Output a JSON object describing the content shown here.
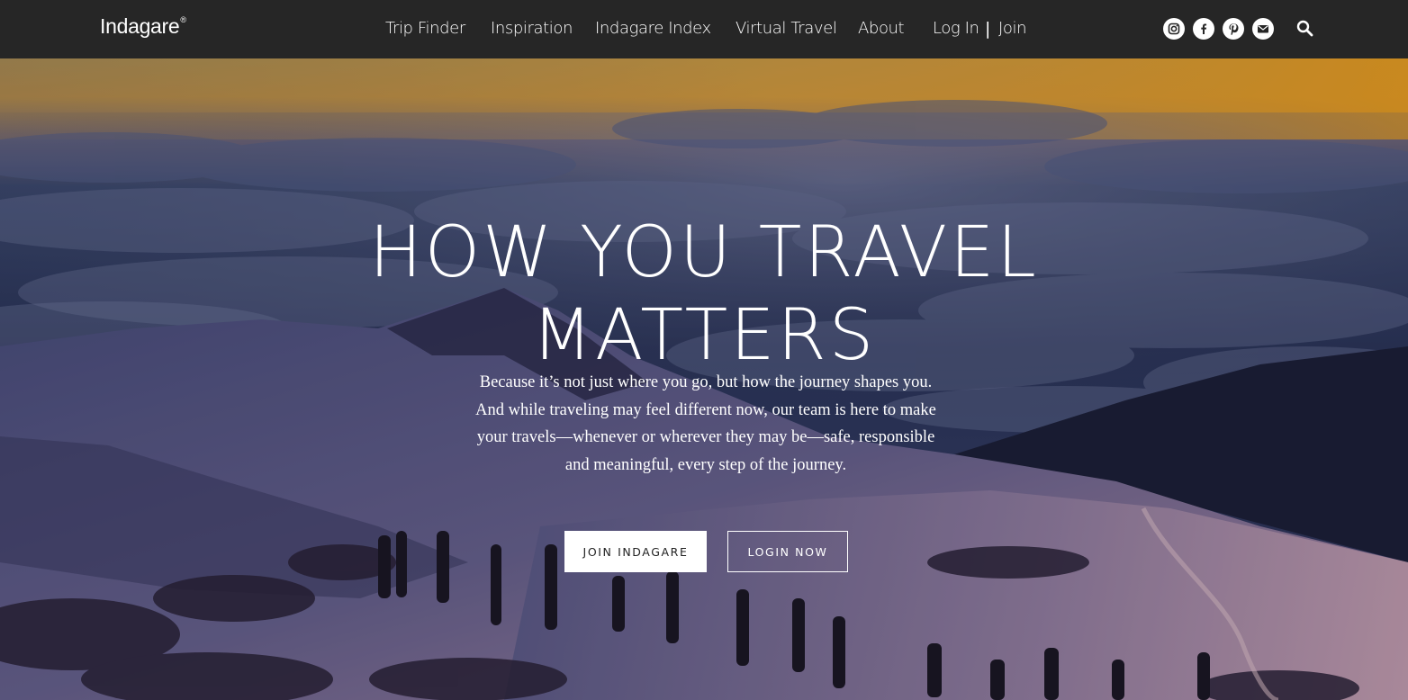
{
  "brand": {
    "name": "Indagare",
    "mark": "®"
  },
  "nav": {
    "items": [
      {
        "label": "Trip Finder"
      },
      {
        "label": "Inspiration"
      },
      {
        "label": "Indagare Index"
      },
      {
        "label": "Virtual Travel"
      },
      {
        "label": "About"
      },
      {
        "label": "Log In"
      },
      {
        "label": "Join"
      }
    ],
    "separator": "|"
  },
  "social": [
    "instagram-icon",
    "facebook-icon",
    "pinterest-icon",
    "email-icon"
  ],
  "search": {
    "icon": "search-icon"
  },
  "hero": {
    "headline_line1": "HOW YOU TRAVEL",
    "headline_line2": "MATTERS",
    "body": "Because it’s not just where you go, but how the journey shapes you. And while traveling may feel different now, our team is here to make your travels—whenever or wherever they may be—safe, responsible and meaningful, every step of the journey.",
    "primary_cta": "JOIN INDAGARE",
    "secondary_cta": "LOGIN NOW"
  },
  "colors": {
    "topbar": "#262626",
    "text": "#ffffff",
    "sunset": "#f0a030",
    "sky_night": "#1c2340"
  }
}
